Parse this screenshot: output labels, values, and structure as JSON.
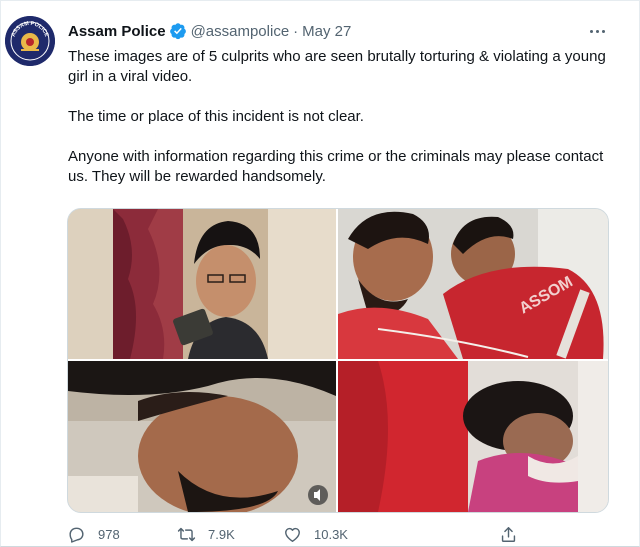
{
  "tweet": {
    "display_name": "Assam Police",
    "handle": "@assampolice",
    "separator": "·",
    "date": "May 27",
    "avatar_text": "ASSAM POLICE",
    "paragraphs": [
      "These images are of 5 culprits who are seen brutally torturing & violating a young girl in a viral video.",
      "The time or place of this incident is not clear.",
      "Anyone with information regarding this crime or the criminals may please contact us. They will be rewarded handsomely."
    ],
    "images": [
      {
        "description_name": "culprit-photo-1"
      },
      {
        "description_name": "culprit-photo-2"
      },
      {
        "description_name": "culprit-photo-3"
      },
      {
        "description_name": "culprit-photo-4"
      }
    ],
    "metrics": {
      "replies": "978",
      "retweets": "7.9K",
      "likes": "10.3K"
    }
  },
  "colors": {
    "text_primary": "#0f1419",
    "text_secondary": "#536471",
    "verified_blue": "#1d9bf0",
    "avatar_navy": "#1f2a6b"
  },
  "icons": [
    "verified-badge-icon",
    "more-options-icon",
    "reply-icon",
    "retweet-icon",
    "like-icon",
    "share-icon",
    "volume-icon"
  ]
}
